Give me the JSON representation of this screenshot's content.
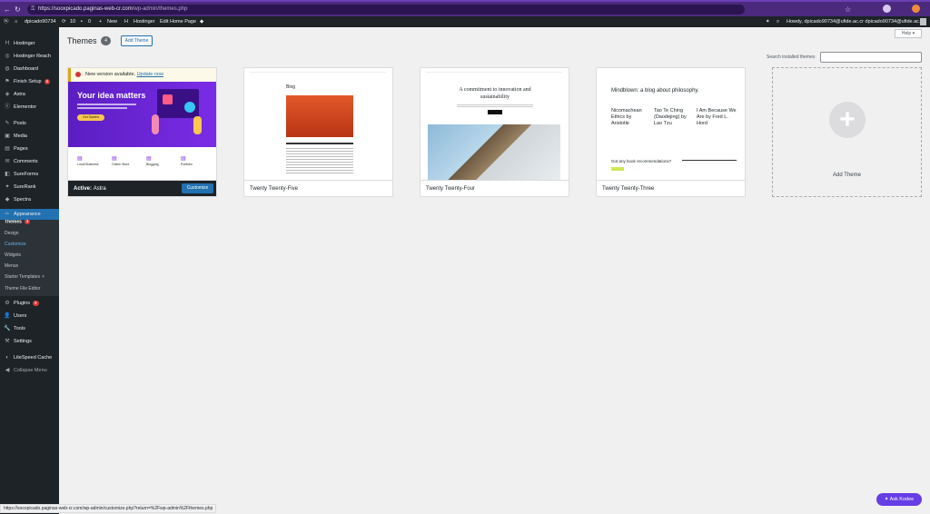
{
  "browser": {
    "url_host": "https://sooxpicado.paginas-web-cr.com",
    "url_path": "/wp-admin/themes.php"
  },
  "adminbar": {
    "site": "dpicado90734",
    "updates": "10",
    "comments": "0",
    "new": "New",
    "hostinger": "Hostinger",
    "edit_home": "Edit Home Page",
    "howdy": "Howdy, dpicado90734@ufide.ac.cr dpicado90734@ufide.ac.cr"
  },
  "sidebar": {
    "items": [
      {
        "label": "Hostinger",
        "icon": "H"
      },
      {
        "label": "Hostinger Reach",
        "icon": "◎"
      },
      {
        "label": "Dashboard",
        "icon": "◍"
      },
      {
        "label": "Finish Setup",
        "icon": "⚑",
        "badge": "6"
      },
      {
        "label": "Astra",
        "icon": "◈"
      },
      {
        "label": "Elementor",
        "icon": "ⓔ"
      },
      {
        "label": "Posts",
        "icon": "✎"
      },
      {
        "label": "Media",
        "icon": "▣"
      },
      {
        "label": "Pages",
        "icon": "▤"
      },
      {
        "label": "Comments",
        "icon": "✉"
      },
      {
        "label": "SureForms",
        "icon": "◧"
      },
      {
        "label": "SureRank",
        "icon": "✦"
      },
      {
        "label": "Spectra",
        "icon": "◆"
      },
      {
        "label": "Appearance",
        "icon": "✏"
      },
      {
        "label": "Plugins",
        "icon": "⚙",
        "badge": "9"
      },
      {
        "label": "Users",
        "icon": "👤"
      },
      {
        "label": "Tools",
        "icon": "🔧"
      },
      {
        "label": "Settings",
        "icon": "⚒"
      },
      {
        "label": "LiteSpeed Cache",
        "icon": "◐"
      },
      {
        "label": "Collapse Menu",
        "icon": "◀"
      }
    ],
    "submenu": [
      {
        "label": "Themes",
        "badge": "1"
      },
      {
        "label": "Design"
      },
      {
        "label": "Customize"
      },
      {
        "label": "Widgets"
      },
      {
        "label": "Menus"
      },
      {
        "label": "Starter Templates"
      },
      {
        "label": "Theme File Editor"
      }
    ]
  },
  "page": {
    "title": "Themes",
    "count": "4",
    "add_theme": "Add Theme",
    "help": "Help ▾",
    "search_label": "Search installed themes"
  },
  "themes": [
    {
      "name": "Astra",
      "active_label": "Active:",
      "notice": "New version available.",
      "update_link": "Update now",
      "customize": "Customize",
      "hero": "Your idea matters",
      "hero_btn": "Get Started",
      "features": [
        "Local Business",
        "Online Store",
        "Blogging",
        "Portfolio"
      ]
    },
    {
      "name": "Twenty Twenty-Five",
      "preview_heading": "Blog"
    },
    {
      "name": "Twenty Twenty-Four",
      "preview_heading": "A commitment to innovation and sustainability"
    },
    {
      "name": "Twenty Twenty-Three",
      "preview_heading": "Mindblown: a blog about philosophy.",
      "posts": [
        "Nicomachean Ethics by Aristotle",
        "Tao Te Ching (Daodejing) by Lao Tzu",
        "I Am Because We Are by Fred L. Hord"
      ],
      "cta": "Got any book recommendations?"
    }
  ],
  "add_new_label": "Add Theme",
  "statusbar": "https://sooxpicado.paginas-web-cr.com/wp-admin/customize.php?return=%2Fwp-admin%2Fthemes.php",
  "kodee": "Ask Kodee",
  "colors": {
    "accent": "#2271b1",
    "sidebar": "#1d2327",
    "badge": "#d63638",
    "browser": "#4b2a7e",
    "kodee": "#673de6"
  }
}
